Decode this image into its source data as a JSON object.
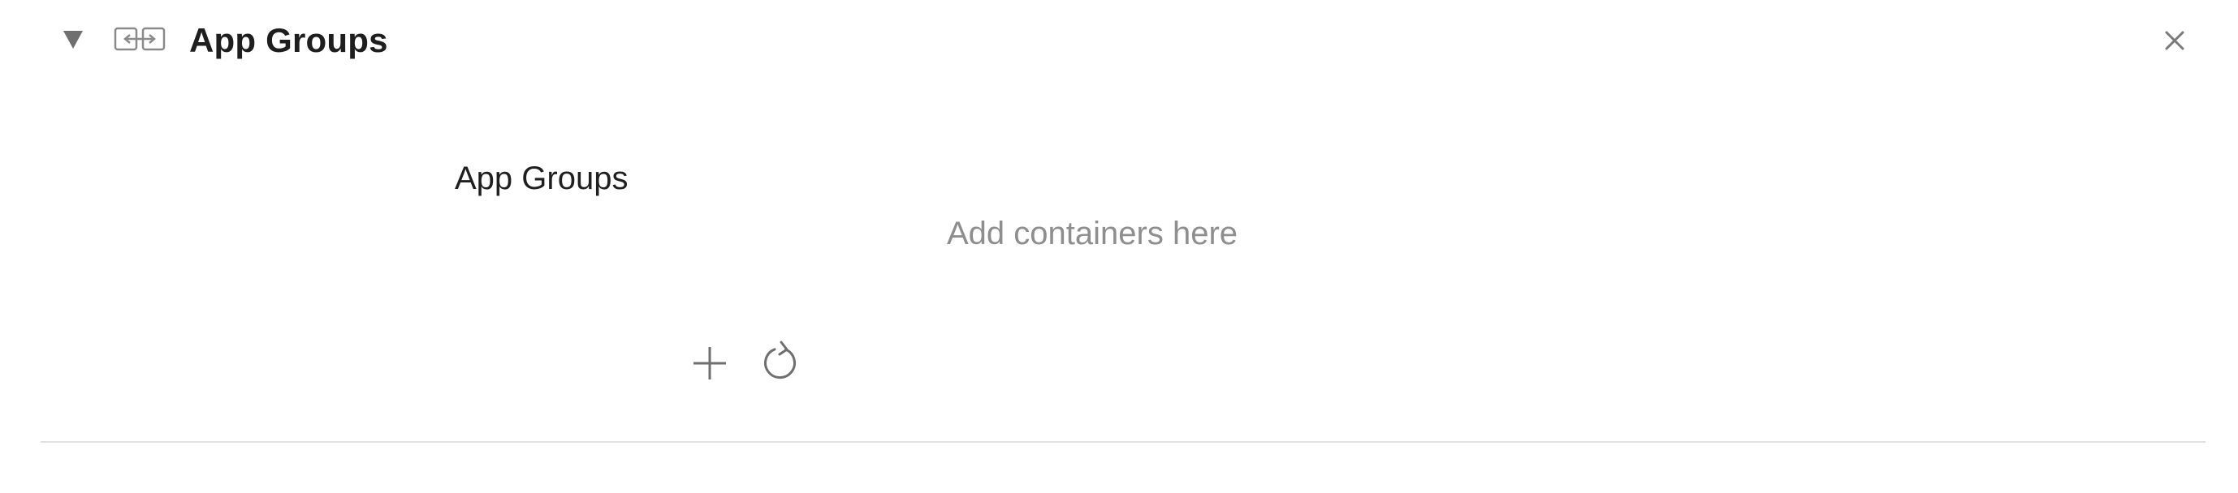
{
  "section": {
    "title": "App Groups",
    "icons": {
      "disclosure": "disclosure-triangle-down-icon",
      "capability": "app-groups-capability-icon",
      "close": "close-icon"
    }
  },
  "field": {
    "label": "App Groups",
    "empty_placeholder": "Add containers here"
  },
  "actions": {
    "icons": {
      "add": "plus-icon",
      "refresh": "refresh-icon"
    }
  },
  "colors": {
    "text_primary": "#1e1e1e",
    "text_placeholder": "#8e8e8e",
    "icon_gray": "#6f6f6f",
    "divider": "#e1e1e1"
  }
}
